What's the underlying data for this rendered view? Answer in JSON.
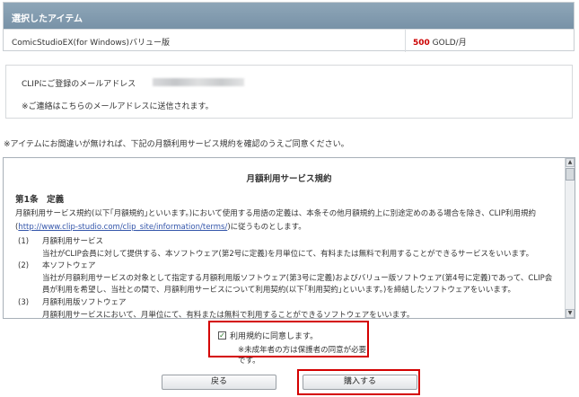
{
  "selected": {
    "header": "選択したアイテム",
    "item_name": "ComicStudioEX(for Windows)バリュー版",
    "price_value": "500",
    "price_unit": " GOLD/月"
  },
  "contact": {
    "label": "CLIPにご登録のメールアドレス",
    "note": "※ご連絡はこちらのメールアドレスに送信されます。"
  },
  "notice": "※アイテムにお間違いが無ければ、下記の月額利用サービス規約を確認のうえご同意ください。",
  "terms": {
    "title": "月額利用サービス規約",
    "article": "第1条　定義",
    "para_a": "月額利用サービス規約(以下｢月額規約｣といいます。)において使用する用語の定義は、本条その他月額規約上に別途定めのある場合を除き、CLIP利用規約(",
    "link": "http://www.clip-studio.com/clip_site/information/terms/",
    "para_b": ")に従うものとします。",
    "items": [
      {
        "num": "(1)",
        "title": "月額利用サービス",
        "desc": "当社がCLIP会員に対して提供する、本ソフトウェア(第2号に定義)を月単位にて、有料または無料で利用することができるサービスをいいます。"
      },
      {
        "num": "(2)",
        "title": "本ソフトウェア",
        "desc": "当社が月額利用サービスの対象として指定する月額利用版ソフトウェア(第3号に定義)およびバリュー版ソフトウェア(第4号に定義)であって、CLIP会員が利用を希望し、当社との間で、月額利用サービスについて利用契約(以下｢利用契約｣といいます。)を締結したソフトウェアをいいます。"
      },
      {
        "num": "(3)",
        "title": "月額利用版ソフトウェア",
        "desc": "月額利用サービスにおいて、月単位にて、有料または無料で利用することができるソフトウェアをいいます。"
      }
    ]
  },
  "agree": {
    "label": "利用規約に同意します。",
    "checked": true,
    "note": "※未成年者の方は保護者の同意が必要です。"
  },
  "buttons": {
    "back": "戻る",
    "buy": "購入する"
  },
  "colors": {
    "header_bg": "#7f98ac",
    "highlight": "#d40000",
    "price": "#cc0000"
  }
}
